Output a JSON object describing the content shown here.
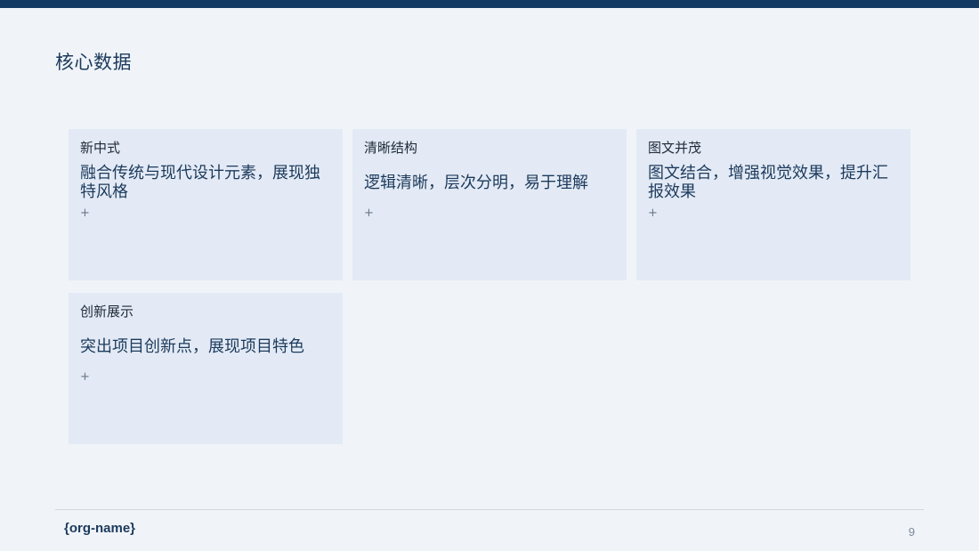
{
  "slide": {
    "title": "核心数据",
    "cards": [
      {
        "label": "新中式",
        "value": "融合传统与现代设计元素，展现独特风格",
        "note": "+"
      },
      {
        "label": "清晰结构",
        "value": "逻辑清晰，层次分明，易于理解",
        "note": "+"
      },
      {
        "label": "图文并茂",
        "value": "图文结合，增强视觉效果，提升汇报效果",
        "note": "+"
      },
      {
        "label": "创新展示",
        "value": "突出项目创新点，展现项目特色",
        "note": "+"
      }
    ]
  },
  "footer": {
    "org_name": "{org-name}",
    "page_number": "9"
  },
  "colors": {
    "accent": "#133a63",
    "card_background": "#e3eaf5",
    "page_background": "#f0f4f9"
  }
}
